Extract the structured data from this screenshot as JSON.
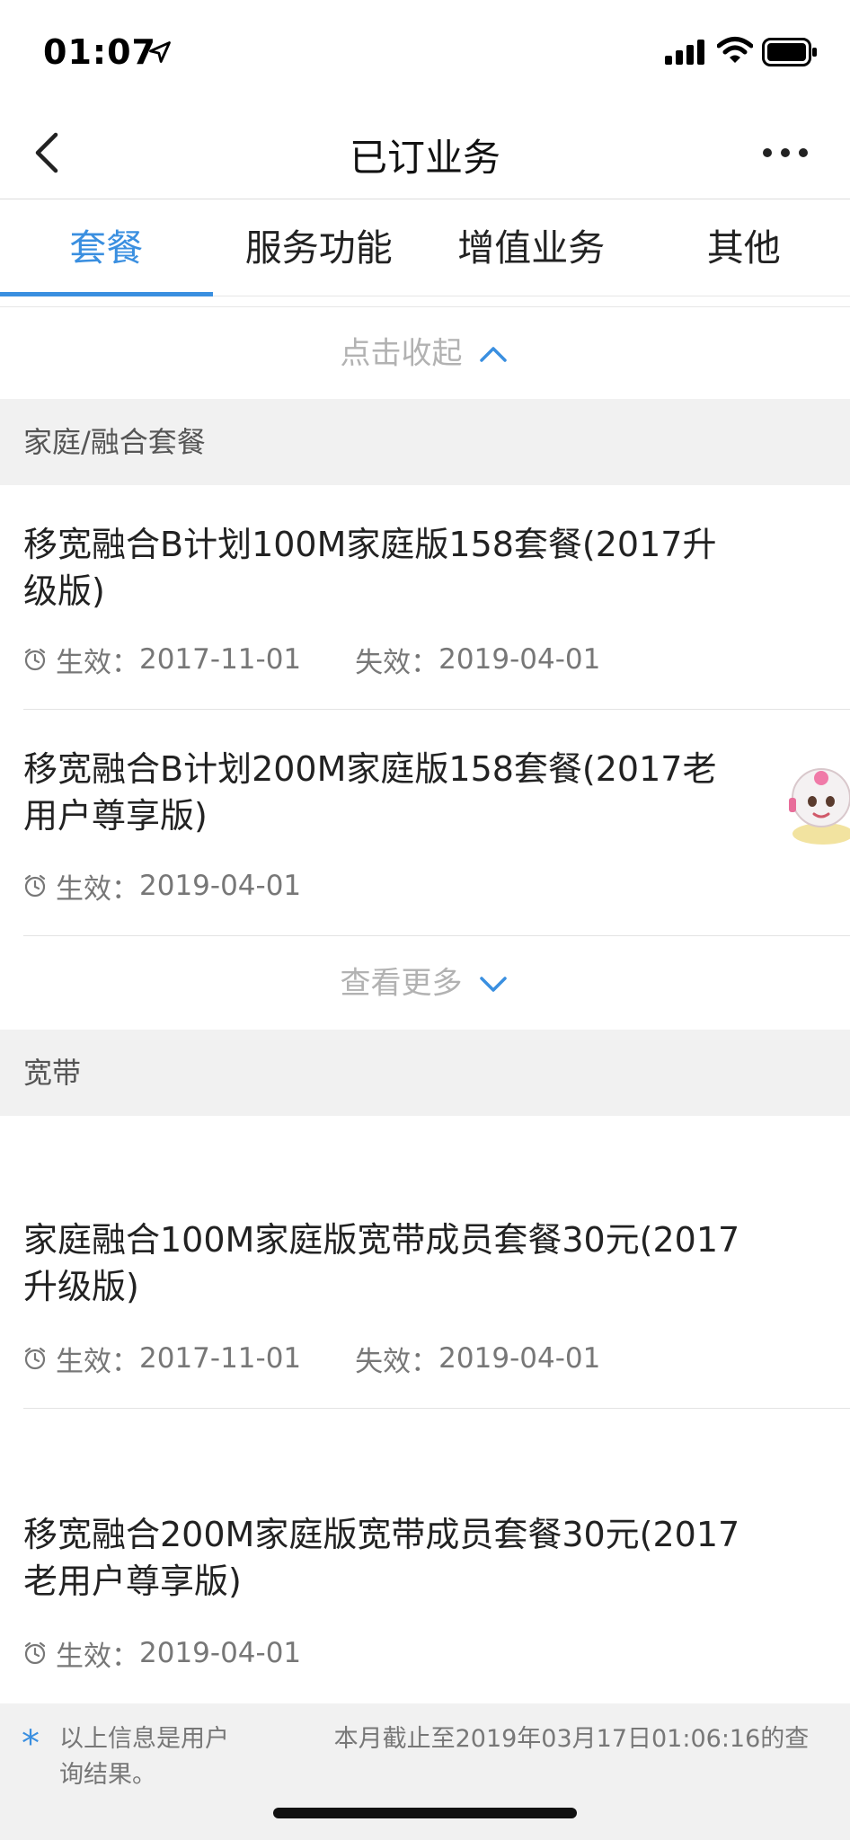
{
  "status_bar": {
    "time": "01:07",
    "icons": [
      "location-arrow-icon",
      "signal-bars-icon",
      "wifi-icon",
      "battery-icon"
    ]
  },
  "nav": {
    "title": "已订业务",
    "back_icon": "chevron-left-icon",
    "more_icon": "more-dots-icon"
  },
  "tabs": [
    {
      "label": "套餐",
      "active": true
    },
    {
      "label": "服务功能",
      "active": false
    },
    {
      "label": "增值业务",
      "active": false
    },
    {
      "label": "其他",
      "active": false
    }
  ],
  "collapse": {
    "label": "点击收起",
    "icon": "chevron-up-icon"
  },
  "sections": [
    {
      "title": "家庭/融合套餐",
      "items": [
        {
          "title": "移宽融合B计划100M家庭版158套餐(2017升级版)",
          "effective_label": "生效：",
          "effective": "2017-11-01",
          "expire_label": "失效：",
          "expire": "2019-04-01"
        },
        {
          "title": "移宽融合B计划200M家庭版158套餐(2017老用户尊享版)",
          "effective_label": "生效：",
          "effective": "2019-04-01"
        }
      ],
      "more_label": "查看更多"
    },
    {
      "title": "宽带",
      "items": [
        {
          "title": "家庭融合100M家庭版宽带成员套餐30元(2017升级版)",
          "effective_label": "生效：",
          "effective": "2017-11-01",
          "expire_label": "失效：",
          "expire": "2019-04-01"
        },
        {
          "title": "移宽融合200M家庭版宽带成员套餐30元(2017老用户尊享版)",
          "effective_label": "生效：",
          "effective": "2019-04-01"
        }
      ]
    }
  ],
  "notice": {
    "star": "*",
    "text": "以上信息是用户 　　　　本月截止至2019年03月17日01:06:16的查询结果。"
  },
  "colors": {
    "accent": "#3a8fe0",
    "section_bg": "#f1f1f1",
    "muted_text": "#b2b2b2"
  }
}
